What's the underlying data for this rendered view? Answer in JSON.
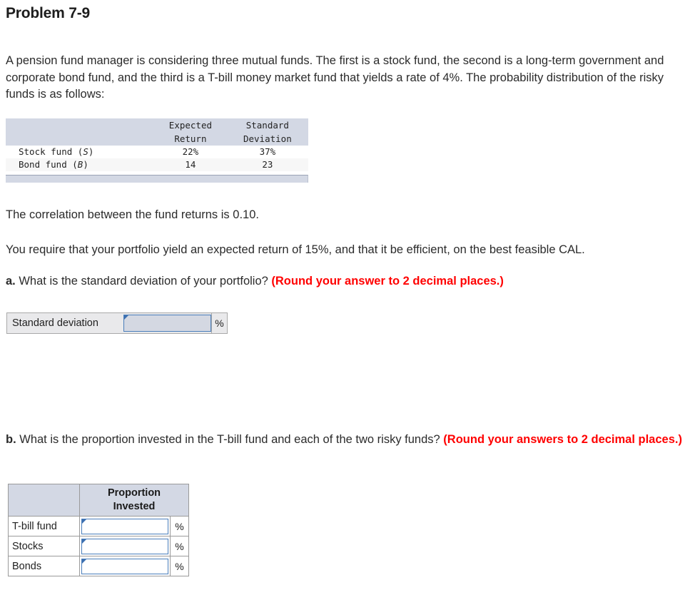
{
  "page_title": "Problem 7-9",
  "intro": "A pension fund manager is considering three mutual funds. The first is a stock fund, the second is a long-term government and corporate bond fund, and the third is a T-bill money market fund that yields a rate of 4%. The probability distribution of the risky funds is as follows:",
  "data_table": {
    "headers": {
      "corner": "",
      "col1_line1": "Expected",
      "col1_line2": "Return",
      "col2_line1": "Standard",
      "col2_line2": "Deviation"
    },
    "rows": [
      {
        "label_prefix": "Stock fund (",
        "label_symbol": "S",
        "label_suffix": ")",
        "expected_return": "22%",
        "standard_deviation": "37%"
      },
      {
        "label_prefix": "Bond fund (",
        "label_symbol": "B",
        "label_suffix": ")",
        "expected_return": "14",
        "standard_deviation": "23"
      }
    ]
  },
  "statements": {
    "correlation": "The correlation between the fund returns is 0.10.",
    "requirement": "You require that your portfolio yield an expected return of 15%, and that it be efficient, on the best feasible CAL."
  },
  "question_a": {
    "letter": "a.",
    "text": " What is the standard deviation of your portfolio? ",
    "hint": "(Round your answer to 2 decimal places.)"
  },
  "answer_a": {
    "label": "Standard deviation",
    "value": "",
    "suffix": "%"
  },
  "question_b": {
    "letter": "b.",
    "text": " What is the proportion invested in the T-bill fund and each of the two risky funds? ",
    "hint": "(Round your answers to 2 decimal places.)"
  },
  "answer_b": {
    "header_blank": "",
    "header_line1": "Proportion",
    "header_line2": "Invested",
    "rows": [
      {
        "name": "T-bill fund",
        "value": "",
        "suffix": "%"
      },
      {
        "name": "Stocks",
        "value": "",
        "suffix": "%"
      },
      {
        "name": "Bonds",
        "value": "",
        "suffix": "%"
      }
    ]
  },
  "colors": {
    "hint_red": "#ff0000",
    "table_header_bg": "#d3d8e4",
    "input_border_blue": "#4a7ebb",
    "input_fill_gray": "#d4d8e2"
  }
}
